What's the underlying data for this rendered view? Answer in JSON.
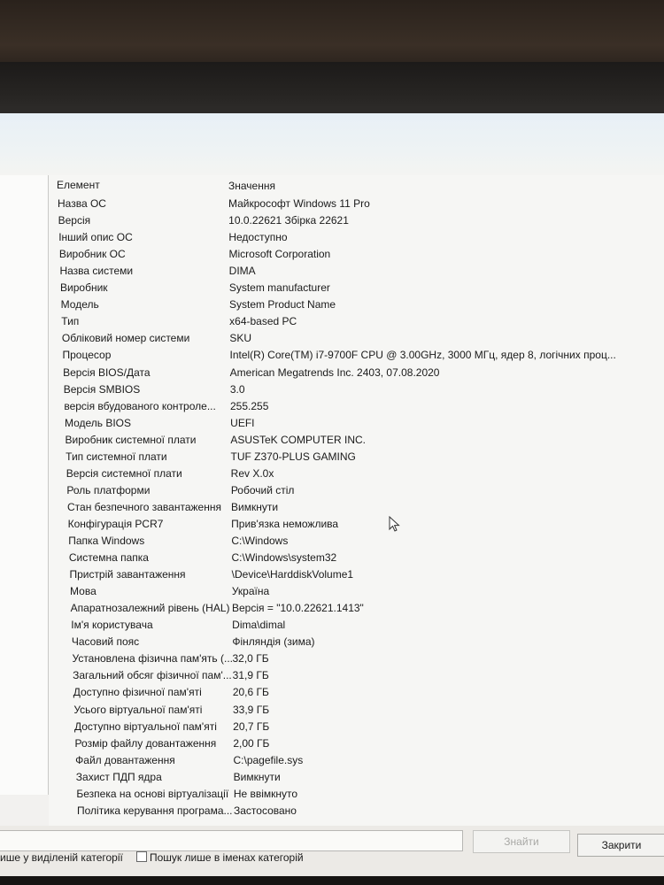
{
  "table": {
    "headers": [
      "Елемент",
      "Значення"
    ],
    "rows": [
      {
        "name": "Назва ОС",
        "value": "Майкрософт Windows 11 Pro"
      },
      {
        "name": "Версія",
        "value": "10.0.22621 Збірка 22621"
      },
      {
        "name": "Інший опис ОС",
        "value": "Недоступно"
      },
      {
        "name": "Виробник ОС",
        "value": "Microsoft Corporation"
      },
      {
        "name": "Назва системи",
        "value": "DIMA"
      },
      {
        "name": "Виробник",
        "value": "System manufacturer"
      },
      {
        "name": "Модель",
        "value": "System Product Name"
      },
      {
        "name": "Тип",
        "value": "x64-based PC"
      },
      {
        "name": "Обліковий номер системи",
        "value": "SKU"
      },
      {
        "name": "Процесор",
        "value": "Intel(R) Core(TM) i7-9700F CPU @ 3.00GHz, 3000 МГц, ядер 8, логічних проц..."
      },
      {
        "name": "Версія BIOS/Дата",
        "value": "American Megatrends Inc. 2403, 07.08.2020"
      },
      {
        "name": "Версія SMBIOS",
        "value": "3.0"
      },
      {
        "name": "версія вбудованого контроле...",
        "value": "255.255"
      },
      {
        "name": "Модель BIOS",
        "value": "UEFI"
      },
      {
        "name": "Виробник системної плати",
        "value": "ASUSTeK COMPUTER INC."
      },
      {
        "name": "Тип системної плати",
        "value": "TUF Z370-PLUS GAMING"
      },
      {
        "name": "Версія системної плати",
        "value": "Rev X.0x"
      },
      {
        "name": "Роль платформи",
        "value": "Робочий стіл"
      },
      {
        "name": "Стан безпечного завантаження",
        "value": "Вимкнути"
      },
      {
        "name": "Конфігурація PCR7",
        "value": "Прив'язка неможлива"
      },
      {
        "name": "Папка Windows",
        "value": "C:\\Windows"
      },
      {
        "name": "Системна папка",
        "value": "C:\\Windows\\system32"
      },
      {
        "name": "Пристрій завантаження",
        "value": "\\Device\\HarddiskVolume1"
      },
      {
        "name": "Мова",
        "value": "Україна"
      },
      {
        "name": "Апаратнозалежний рівень (HAL)",
        "value": "Версія = \"10.0.22621.1413\""
      },
      {
        "name": "Ім'я користувача",
        "value": "Dima\\dimal"
      },
      {
        "name": "Часовий пояс",
        "value": "Фінляндія (зима)"
      },
      {
        "name": "Установлена фізична пам'ять (...",
        "value": "32,0 ГБ"
      },
      {
        "name": "Загальний обсяг фізичної пам'...",
        "value": "31,9 ГБ"
      },
      {
        "name": "Доступно фізичної пам'яті",
        "value": "20,6 ГБ"
      },
      {
        "name": "Усього віртуальної пам'яті",
        "value": "33,9 ГБ"
      },
      {
        "name": "Доступно віртуальної пам'яті",
        "value": "20,7 ГБ"
      },
      {
        "name": "Розмір файлу довантаження",
        "value": "2,00 ГБ"
      },
      {
        "name": "Файл довантаження",
        "value": "C:\\pagefile.sys"
      },
      {
        "name": "Захист ПДП ядра",
        "value": "Вимкнути"
      },
      {
        "name": "Безпека на основі віртуалізації",
        "value": "Не ввімкнуто"
      },
      {
        "name": "Політика керування програма...",
        "value": "Застосовано"
      }
    ]
  },
  "buttons": {
    "find": "Знайти",
    "close": "Закрити"
  },
  "checkboxes": {
    "selected_category": "ише у виділеній категорії",
    "category_names": "Пошук лише в іменах категорій"
  }
}
